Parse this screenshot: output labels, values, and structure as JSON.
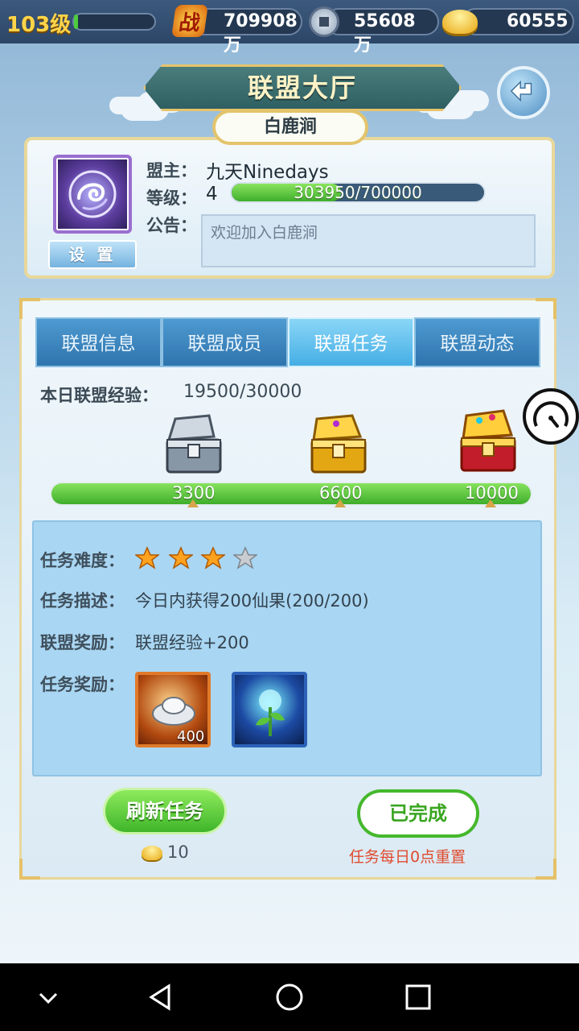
{
  "status_bar": {
    "level": "103级",
    "level_progress": 0.05,
    "power": "709908万",
    "power_icon_text": "战",
    "copper": "55608万",
    "gold": "60555"
  },
  "header": {
    "title": "联盟大厅",
    "alliance_name": "白鹿涧"
  },
  "info": {
    "leader_label": "盟主：",
    "leader_value": "九天Ninedays",
    "level_label": "等级：",
    "level_value": "4",
    "exp_text": "303950/700000",
    "exp_fraction": 0.434,
    "notice_label": "公告：",
    "notice_text": "欢迎加入白鹿涧",
    "settings_label": "设 置"
  },
  "tabs": [
    {
      "label": "联盟信息"
    },
    {
      "label": "联盟成员"
    },
    {
      "label": "联盟任务"
    },
    {
      "label": "联盟动态"
    }
  ],
  "daily_exp": {
    "label": "本日联盟经验：",
    "value": "19500/30000",
    "fraction": 1.0,
    "milestones": [
      "3300",
      "6600",
      "10000"
    ]
  },
  "task": {
    "difficulty_label": "任务难度：",
    "difficulty_stars": 3,
    "difficulty_max": 4,
    "desc_label": "任务描述：",
    "desc_value": "今日内获得200仙果(200/200)",
    "alliance_reward_label": "联盟奖励：",
    "alliance_reward_value": "联盟经验+200",
    "task_reward_label": "任务奖励：",
    "reward_items": [
      {
        "icon": "silver-ingot-icon",
        "count": "400"
      },
      {
        "icon": "glowing-seedling-icon",
        "count": ""
      }
    ]
  },
  "actions": {
    "refresh_label": "刷新任务",
    "refresh_cost": "10",
    "done_label": "已完成",
    "reset_note": "任务每日0点重置"
  },
  "colors": {
    "accent_green": "#3fae2b",
    "tab_active": "#45aee5",
    "tab_inactive": "#2f74ad",
    "gold_trim": "#e5c167"
  }
}
